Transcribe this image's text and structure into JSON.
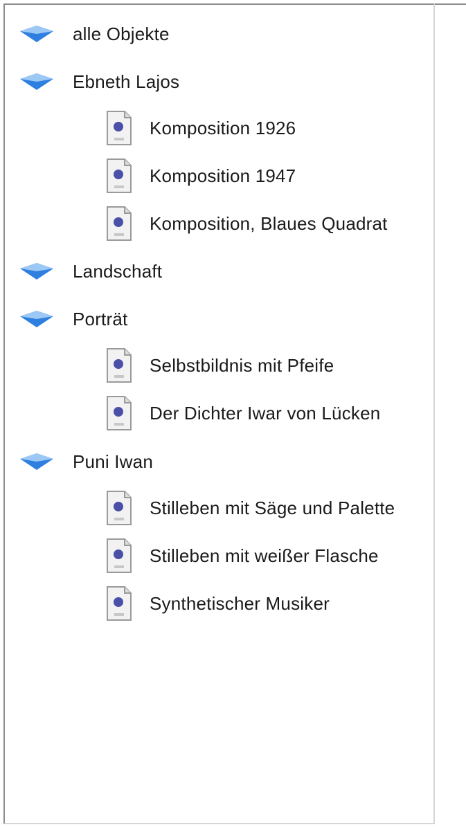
{
  "tree": {
    "groups": [
      {
        "label": "alle Objekte",
        "icon": "diamond-icon",
        "children": []
      },
      {
        "label": "Ebneth Lajos",
        "icon": "diamond-icon",
        "children": [
          {
            "label": "Komposition 1926",
            "icon": "document-icon"
          },
          {
            "label": "Komposition 1947",
            "icon": "document-icon"
          },
          {
            "label": "Komposition, Blaues Quadrat",
            "icon": "document-icon"
          }
        ]
      },
      {
        "label": "Landschaft",
        "icon": "diamond-icon",
        "children": []
      },
      {
        "label": "Porträt",
        "icon": "diamond-icon",
        "children": [
          {
            "label": "Selbstbildnis mit Pfeife",
            "icon": "document-icon"
          },
          {
            "label": "Der Dichter Iwar von Lücken",
            "icon": "document-icon"
          }
        ]
      },
      {
        "label": "Puni Iwan",
        "icon": "diamond-icon",
        "children": [
          {
            "label": "Stilleben mit Säge und Palette",
            "icon": "document-icon"
          },
          {
            "label": "Stilleben mit weißer Flasche",
            "icon": "document-icon"
          },
          {
            "label": "Synthetischer Musiker",
            "icon": "document-icon"
          }
        ]
      }
    ]
  },
  "colors": {
    "diamond_top": "#9cc8f5",
    "diamond_bottom": "#2f7fe0",
    "doc_paper": "#f2f2f2",
    "doc_mark": "#4a4fa8"
  }
}
